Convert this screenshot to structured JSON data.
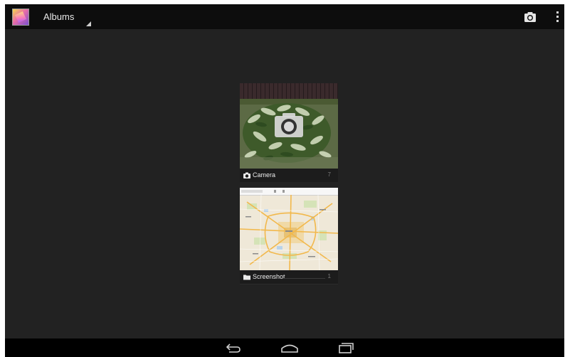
{
  "action_bar": {
    "title": "Albums"
  },
  "albums": [
    {
      "label": "Camera",
      "count": "7",
      "icon": "camera-icon"
    },
    {
      "label": "Screenshot",
      "count": "1",
      "icon": "folder-icon"
    }
  ],
  "icons": {
    "app": "gallery-app-icon",
    "camera_action": "camera-icon",
    "overflow": "overflow-menu-icon",
    "nav": [
      "back-icon",
      "home-icon",
      "recent-apps-icon"
    ]
  },
  "colors": {
    "screen_background": "#222222",
    "action_bar": "#0d0d0d",
    "nav_bar": "#000000",
    "caption_text": "#eaeaea"
  }
}
